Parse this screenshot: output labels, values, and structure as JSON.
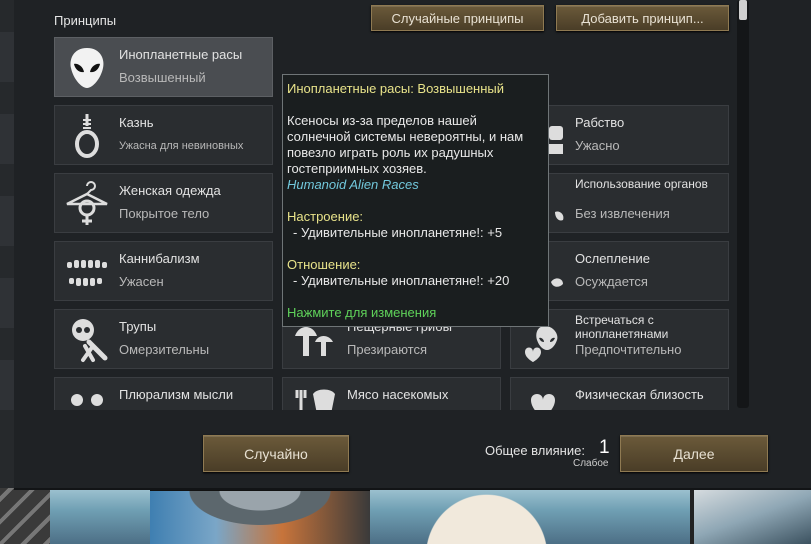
{
  "section_title": "Принципы",
  "buttons": {
    "random_principles": "Случайные принципы",
    "add_principle": "Добавить принцип...",
    "random": "Случайно",
    "next": "Далее"
  },
  "influence": {
    "label": "Общее влияние:",
    "value": "1",
    "level": "Слабое"
  },
  "cards": [
    {
      "title": "Инопланетные расы",
      "value": "Возвышенный",
      "icon": "alien-head-icon"
    },
    {
      "title": "Казнь",
      "value": "Ужасна для невиновных",
      "icon": "noose-icon"
    },
    {
      "title": "Женская одежда",
      "value": "Покрытое тело",
      "icon": "female-clothing-icon"
    },
    {
      "title": "Каннибализм",
      "value": "Ужасен",
      "icon": "teeth-icon"
    },
    {
      "title": "Трупы",
      "value": "Омерзительны",
      "icon": "skull-bones-icon"
    },
    {
      "title": "Плюрализм мысли",
      "value": "",
      "icon": "pluralism-icon"
    },
    {
      "title": "Пещерные грибы",
      "value": "Презираются",
      "icon": "mushroom-icon"
    },
    {
      "title": "Мясо насекомых",
      "value": "",
      "icon": "insect-meat-icon"
    },
    {
      "title": "Рабство",
      "value": "Ужасно",
      "icon": "slavery-icon"
    },
    {
      "title": "Использование органов",
      "value": "Без извлечения",
      "icon": "organ-icon"
    },
    {
      "title": "Ослепление",
      "value": "Осуждается",
      "icon": "blinding-icon"
    },
    {
      "title": "Встречаться с инопланетянами",
      "value": "Предпочтительно",
      "icon": "alien-heart-icon"
    },
    {
      "title": "Физическая близость",
      "value": "",
      "icon": "heart-icon"
    }
  ],
  "tooltip": {
    "title": "Инопланетные расы: Возвышенный",
    "description": "Ксеносы из-за пределов нашей солнечной системы невероятны, и нам повезло играть роль их радушных гостеприимных хозяев.",
    "alien_tag": "Humanoid Alien Races",
    "mood_label": "Настроение:",
    "mood_line": "- Удивительные инопланетяне!: +5",
    "opinion_label": "Отношение:",
    "opinion_line": "- Удивительные инопланетяне!: +20",
    "click_hint": "Нажмите для изменения"
  }
}
